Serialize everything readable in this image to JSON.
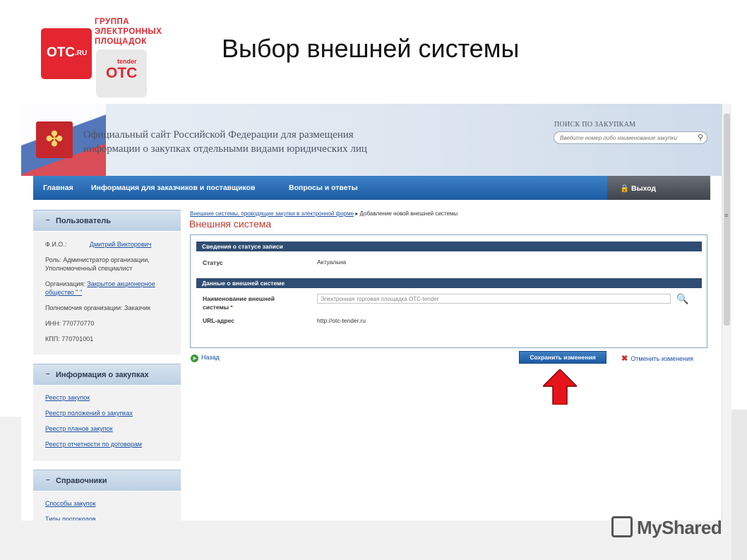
{
  "slide": {
    "title": "Выбор внешней системы",
    "logo_otc_main": "OTC",
    "logo_otc_suffix": ".RU",
    "logo_group_lines": [
      "ГРУППА",
      "ЭЛЕКТРОННЫХ",
      "ПЛОЩАДОК"
    ],
    "logo_tender_small": "tender",
    "logo_tender_big": "OTC",
    "watermark": "MyShared",
    "arrow_color": "#e8141b"
  },
  "site": {
    "title_line1": "Официальный сайт Российской Федерации для размещения",
    "title_line2": "информации о закупках отдельными видами юридических лиц",
    "search_label": "ПОИСК ПО ЗАКУПКАМ",
    "search_placeholder": "Введите номер либо наименование закупки"
  },
  "nav": {
    "home": "Главная",
    "info": "Информация для заказчиков и поставщиков",
    "faq": "Вопросы и ответы",
    "exit": "Выход"
  },
  "sidebar": {
    "user": {
      "header": "Пользователь",
      "fio_label": "Ф.И.О.:",
      "fio_value": "Дмитрий Викторович",
      "role_line1": "Роль: Администратор организации,",
      "role_line2": "Уполномоченный специалист",
      "org_label": "Организация:",
      "org_value_line1": "Закрытое акционерное",
      "org_value_line2": "общество \"                         \"",
      "powers": "Полномочия организации: Заказчик",
      "inn": "ИНН: 770770770",
      "kpp": "КПП: 770701001"
    },
    "purchases": {
      "header": "Информация о закупках",
      "links": [
        "Реестр закупок",
        "Реестр положений о закупках",
        "Реестр планов закупок",
        "Реестр отчетности по договорам"
      ]
    },
    "refs": {
      "header": "Справочники",
      "links": [
        "Способы закупок",
        "Типы протоколов"
      ]
    }
  },
  "content": {
    "breadcrumb_link": "Внешние системы, проводящие закупки в электронной форме",
    "breadcrumb_current": "Добавление новой внешней системы",
    "page_title": "Внешняя система",
    "section1_title": "Сведения о статусе записи",
    "status_label": "Статус",
    "status_value": "Актуальна",
    "section2_title": "Данные о внешней системе",
    "name_label_line1": "Наименование внешней",
    "name_label_line2": "системы",
    "required_mark": "*",
    "name_value": "Электронная торговая площадка OTC-tender",
    "url_label": "URL-адрес",
    "url_value": "http://otc-tender.ru",
    "back": "Назад",
    "save": "Сохранить изменения",
    "cancel": "Отменить изменения"
  }
}
